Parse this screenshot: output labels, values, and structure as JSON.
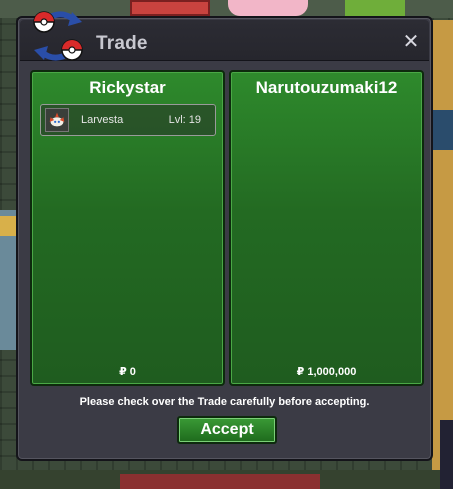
{
  "dialog": {
    "title": "Trade",
    "close_label": "✕",
    "logo_icon": "pokeball-trade-icon"
  },
  "left_panel": {
    "name": "Rickystar",
    "items": [
      {
        "name": "Larvesta",
        "level": "Lvl: 19",
        "icon": "larvesta-icon"
      }
    ],
    "money": "₽ 0"
  },
  "right_panel": {
    "name": "Narutouzumaki12",
    "items": [],
    "money": "₽ 1,000,000"
  },
  "notice": "Please check over the Trade carefully before accepting.",
  "accept_label": "Accept",
  "colors": {
    "panel_green": "#2e8a2c",
    "dialog_bg": "#3b3b45",
    "title_text": "#c8c8d0"
  }
}
